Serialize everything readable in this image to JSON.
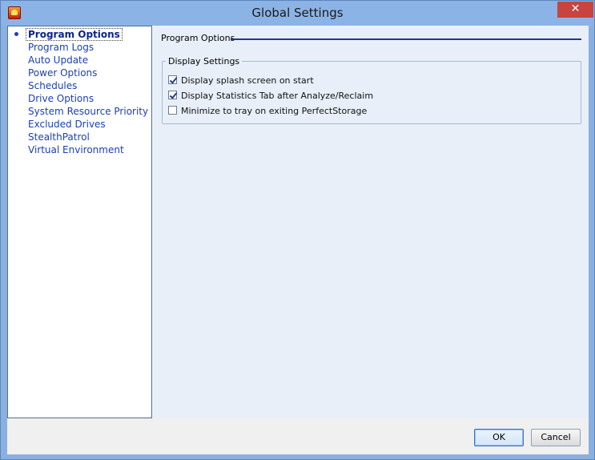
{
  "window": {
    "title": "Global Settings",
    "close_glyph": "✕"
  },
  "nav": {
    "items": [
      {
        "label": "Program Options",
        "selected": true
      },
      {
        "label": "Program Logs"
      },
      {
        "label": "Auto Update"
      },
      {
        "label": "Power Options"
      },
      {
        "label": "Schedules"
      },
      {
        "label": "Drive Options"
      },
      {
        "label": "System Resource Priority"
      },
      {
        "label": "Excluded Drives"
      },
      {
        "label": "StealthPatrol"
      },
      {
        "label": "Virtual Environment"
      }
    ]
  },
  "content": {
    "section_title": "Program Options",
    "group": {
      "label": "Display Settings",
      "options": [
        {
          "label": "Display splash screen on start",
          "checked": true
        },
        {
          "label": "Display Statistics Tab after Analyze/Reclaim",
          "checked": true
        },
        {
          "label": "Minimize to tray on exiting PerfectStorage",
          "checked": false
        }
      ]
    }
  },
  "footer": {
    "ok_label": "OK",
    "cancel_label": "Cancel"
  },
  "colors": {
    "title_bar": "#8cb3e6",
    "close_button": "#c7443f",
    "nav_link": "#1b3fb5",
    "section_rule": "#1c3a8f"
  }
}
